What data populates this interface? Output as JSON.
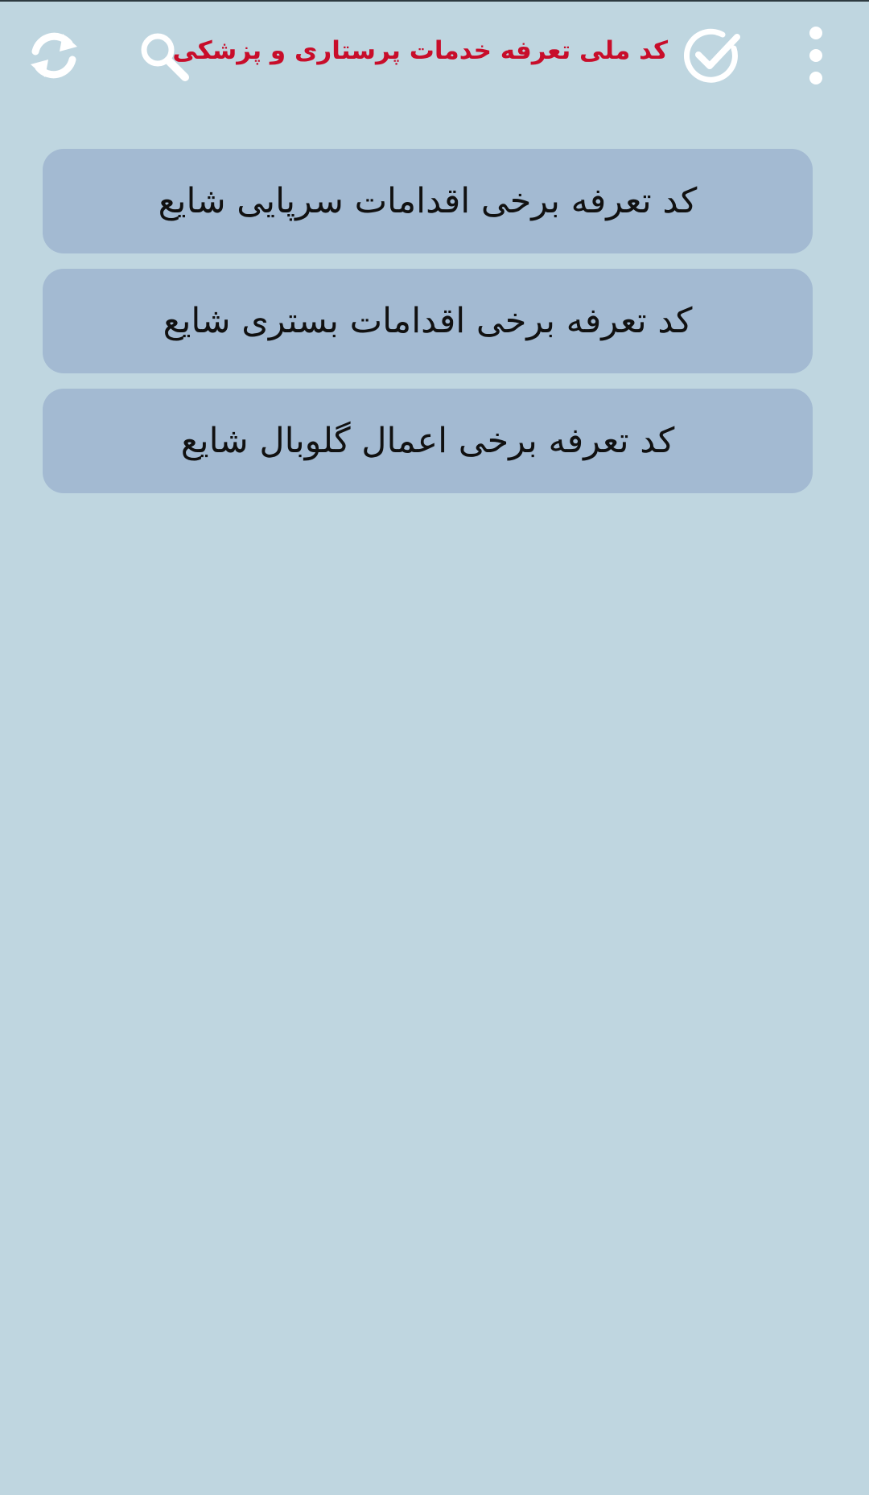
{
  "header": {
    "title": "کد ملی تعرفه خدمات پرستاری و پزشکی",
    "title_color": "#c80d2a",
    "icons": [
      "refresh-icon",
      "search-icon",
      "check-circle-icon",
      "more-vert-icon"
    ]
  },
  "menu": {
    "items": [
      {
        "label": "کد تعرفه برخی اقدامات سرپایی شایع"
      },
      {
        "label": "کد تعرفه برخی اقدامات بستری شایع"
      },
      {
        "label": "کد تعرفه برخی اعمال گلوبال شایع"
      }
    ]
  },
  "colors": {
    "background": "#bfd6e0",
    "button": "#a3bad2",
    "icon": "#ffffff"
  }
}
